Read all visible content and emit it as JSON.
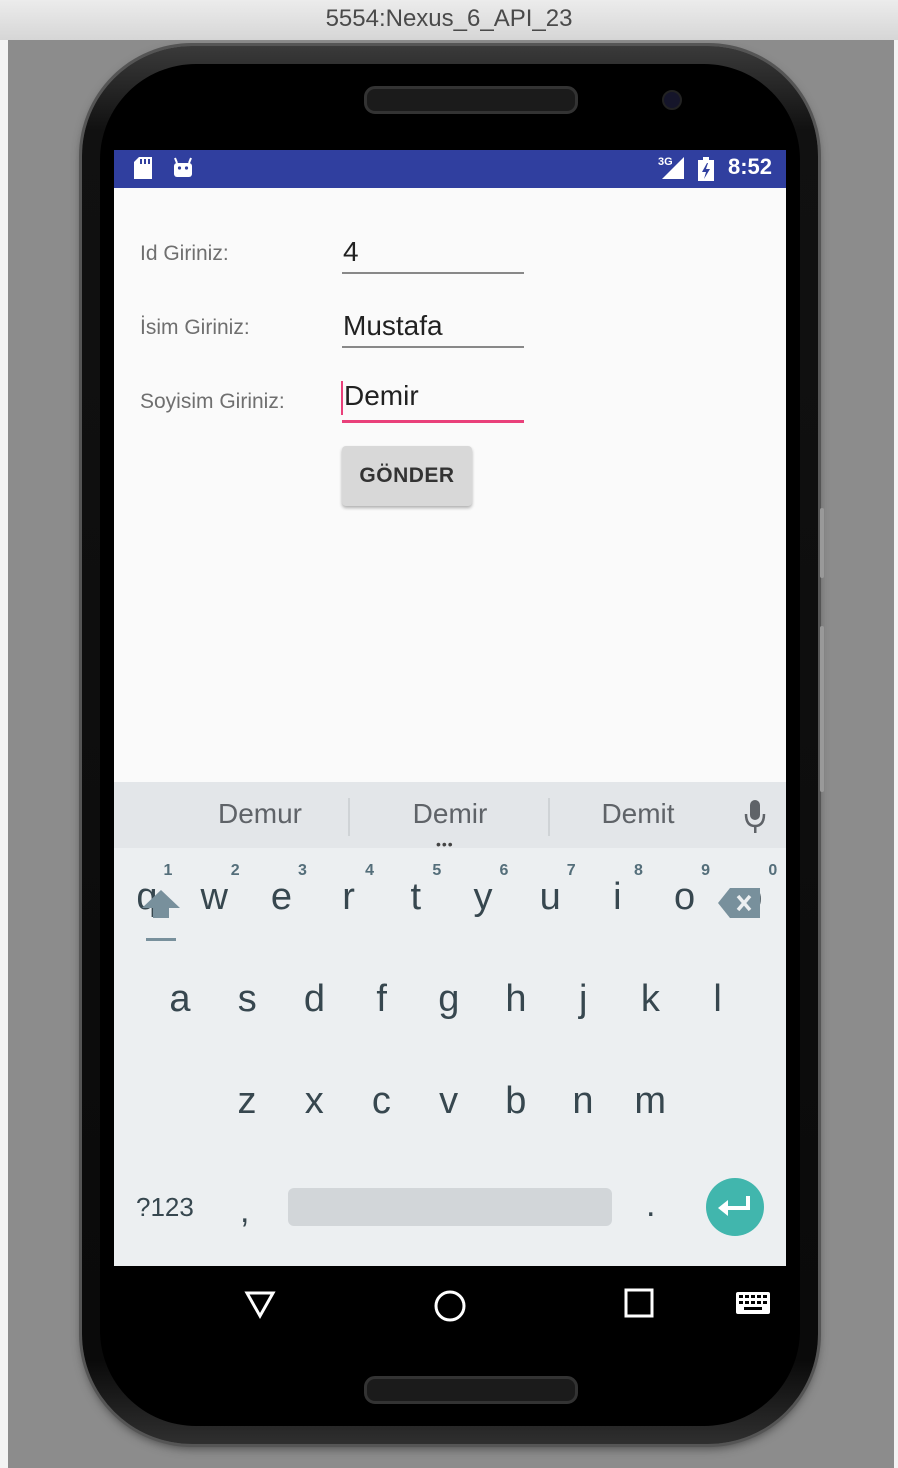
{
  "window": {
    "title": "5554:Nexus_6_API_23"
  },
  "statusbar": {
    "network": "3G",
    "time": "8:52"
  },
  "form": {
    "id_label": "Id Giriniz:",
    "id_value": "4",
    "name_label": "İsim Giriniz:",
    "name_value": "Mustafa",
    "surname_label": "Soyisim Giriniz:",
    "surname_value": "Demir",
    "submit_label": "GÖNDER"
  },
  "keyboard": {
    "suggestions": [
      "Demur",
      "Demir",
      "Demit"
    ],
    "row1": [
      "q",
      "w",
      "e",
      "r",
      "t",
      "y",
      "u",
      "i",
      "o",
      "p"
    ],
    "row1_hints": [
      "1",
      "2",
      "3",
      "4",
      "5",
      "6",
      "7",
      "8",
      "9",
      "0"
    ],
    "row2": [
      "a",
      "s",
      "d",
      "f",
      "g",
      "h",
      "j",
      "k",
      "l"
    ],
    "row3": [
      "z",
      "x",
      "c",
      "v",
      "b",
      "n",
      "m"
    ],
    "symbols_label": "?123",
    "comma": ",",
    "period": "."
  },
  "colors": {
    "statusbar": "#303f9f",
    "accent": "#e9407a",
    "enter": "#41b6ad"
  }
}
